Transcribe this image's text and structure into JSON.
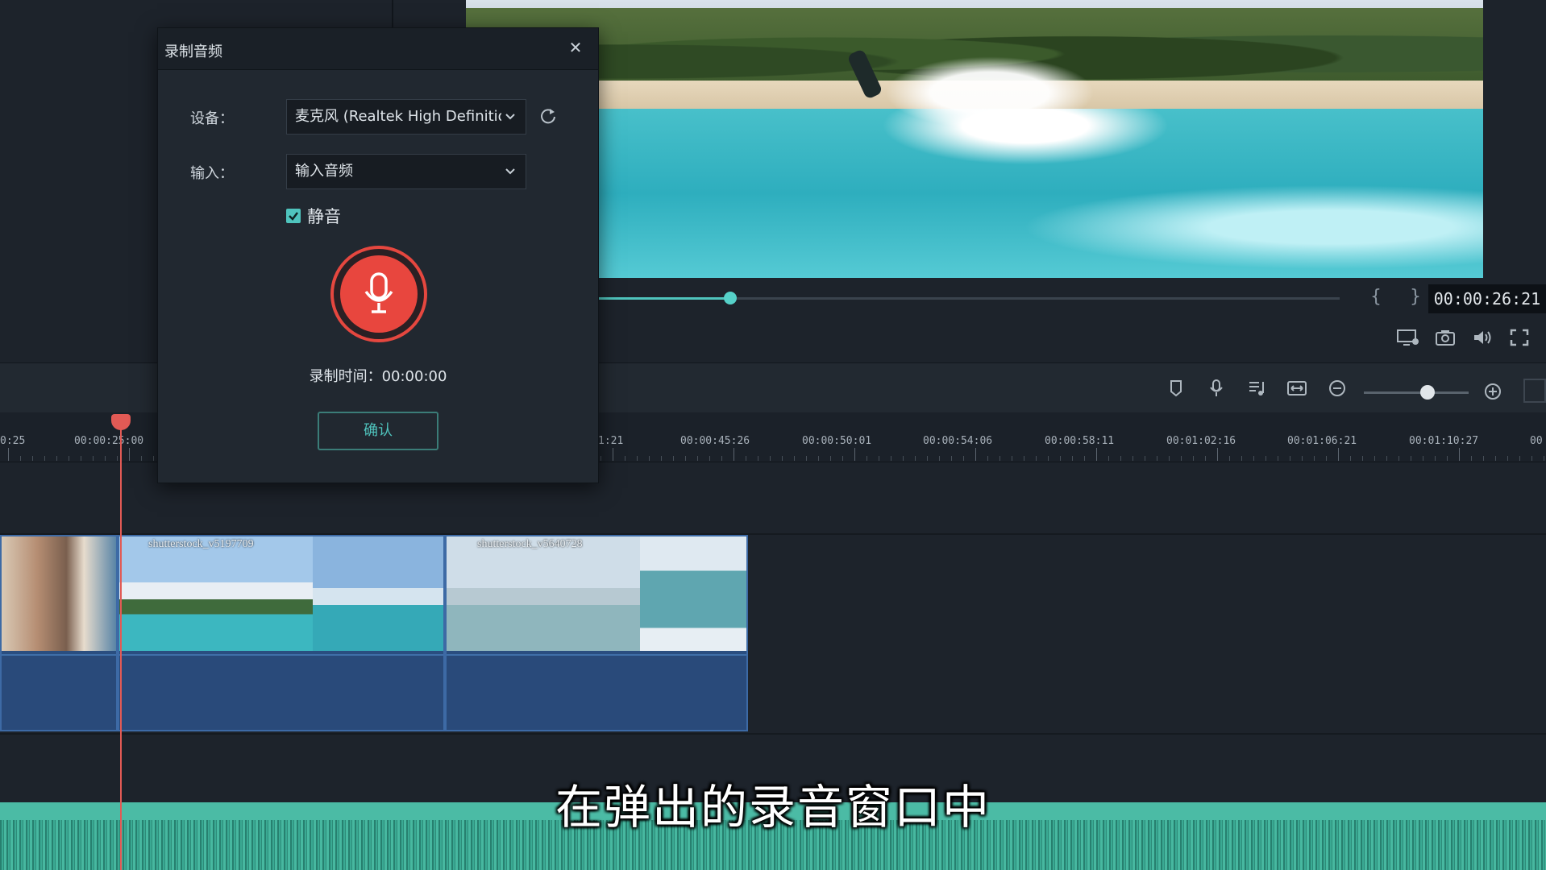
{
  "dialog": {
    "title": "录制音频",
    "close_glyph": "✕",
    "device_label": "设备：",
    "device_value": "麦克风 (Realtek High Definition",
    "input_label": "输入：",
    "input_value": "输入音频",
    "mute_label": "静音",
    "mute_checked": true,
    "record_time_label": "录制时间：",
    "record_time_value": "00:00:00",
    "confirm_label": "确认"
  },
  "player": {
    "timecode": "00:00:26:21",
    "progress_fraction": 0.18
  },
  "ruler": {
    "labels": [
      "0:25",
      "00:00:25:00",
      "1:21",
      "00:00:45:26",
      "00:00:50:01",
      "00:00:54:06",
      "00:00:58:11",
      "00:01:02:16",
      "00:01:06:21",
      "00:01:10:27",
      "00"
    ]
  },
  "clips": [
    {
      "name": ""
    },
    {
      "name": "shutterstock_v5197709"
    },
    {
      "name": "shutterstock_v5640728"
    }
  ],
  "subtitle": "在弹出的录音窗口中",
  "icons": [
    "close-icon",
    "chevron-down-icon",
    "refresh-icon",
    "checkbox-check-icon",
    "microphone-icon",
    "display-settings-icon",
    "camera-icon",
    "volume-icon",
    "fullscreen-icon",
    "marker-icon",
    "voiceover-icon",
    "audio-mix-icon",
    "fit-timeline-icon",
    "zoom-out-icon",
    "zoom-in-icon"
  ],
  "colors": {
    "accent": "#4fc4bd",
    "record": "#e8463e",
    "playhead": "#e25a55",
    "clip": "#2a4e80",
    "audio": "#2f9b86"
  }
}
